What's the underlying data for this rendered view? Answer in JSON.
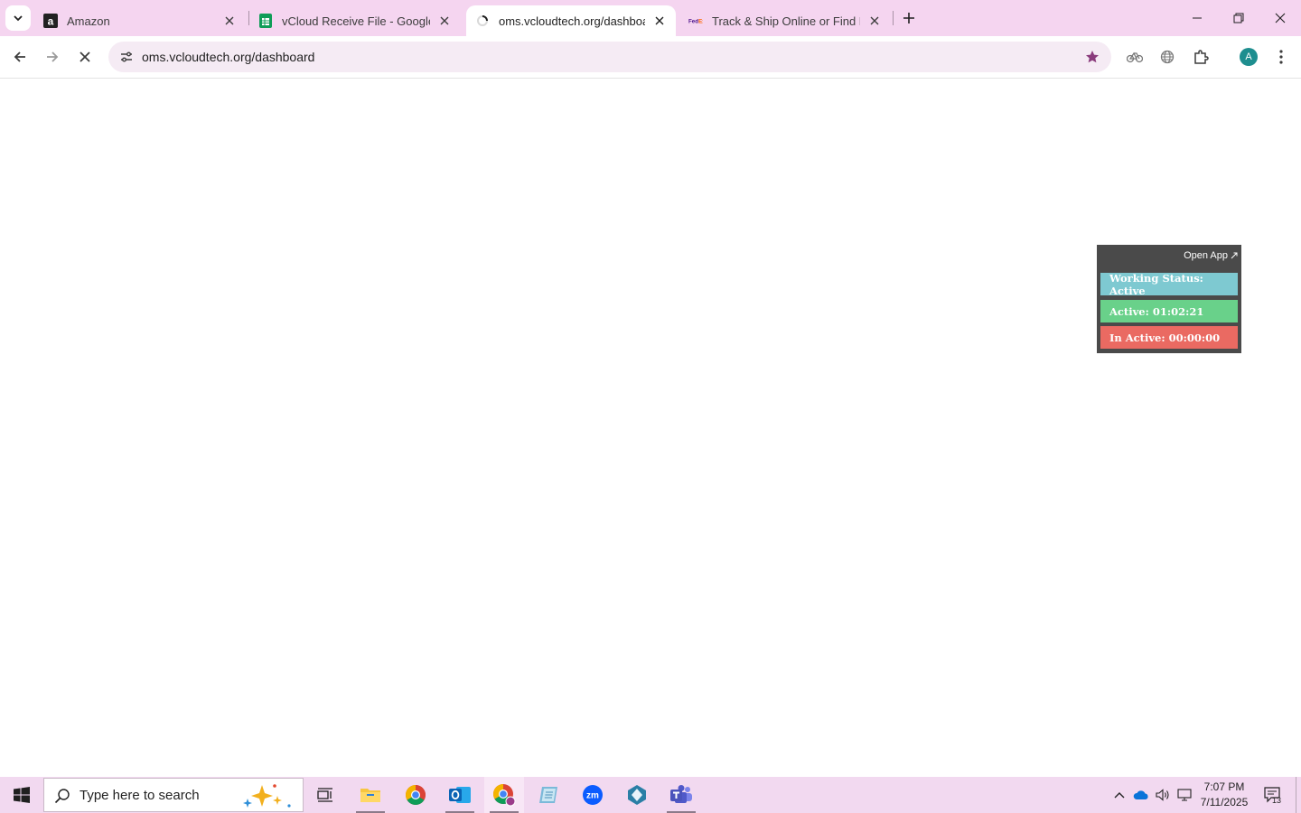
{
  "browser": {
    "tabs": [
      {
        "title": "Amazon",
        "favicon": "amazon-icon",
        "active": false
      },
      {
        "title": "vCloud Receive File - Google Sh",
        "favicon": "google-sheets-icon",
        "active": false
      },
      {
        "title": "oms.vcloudtech.org/dashboard",
        "favicon": "loading-icon",
        "active": true
      },
      {
        "title": "Track & Ship Online or Find Ne",
        "favicon": "fedex-icon",
        "active": false
      }
    ],
    "address": "oms.vcloudtech.org/dashboard",
    "profile_initial": "A"
  },
  "widget": {
    "open_app": "Open App",
    "working_status": "Working Status: Active",
    "active_time": "Active: 01:02:21",
    "inactive_time": "In Active: 00:00:00",
    "colors": {
      "working": "#7ec9d1",
      "active": "#69d18a",
      "inactive": "#ea6a62",
      "panel": "#4a4a4a"
    }
  },
  "taskbar": {
    "search_placeholder": "Type here to search",
    "time": "7:07 PM",
    "date": "7/11/2025",
    "notification_count": "13"
  }
}
